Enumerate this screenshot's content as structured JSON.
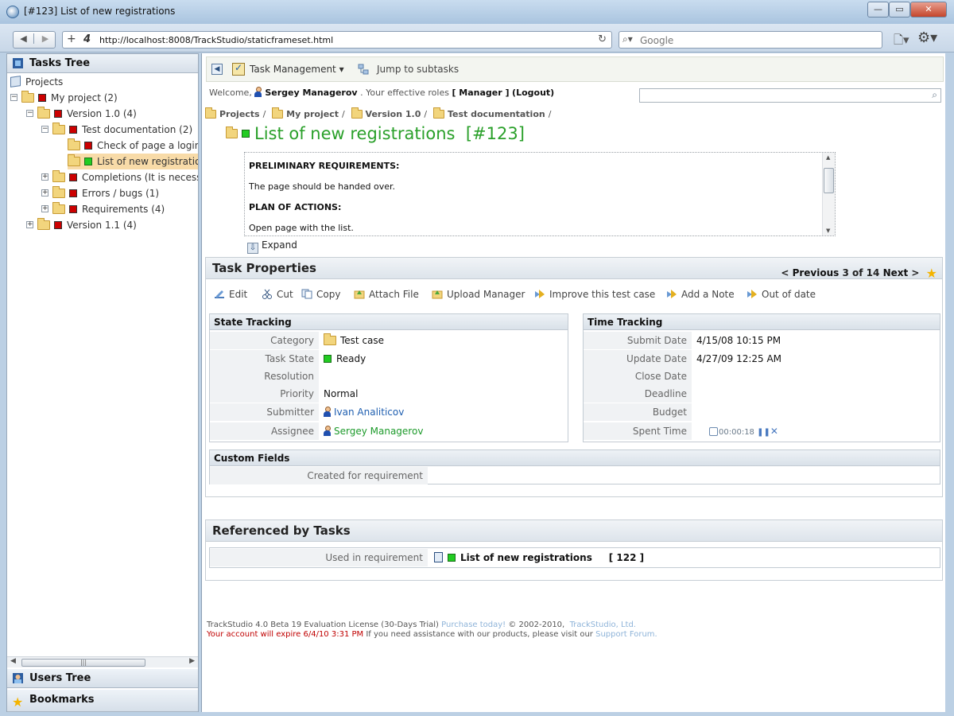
{
  "window": {
    "title": "[#123] List of new registrations",
    "url": "http://localhost:8008/TrackStudio/staticframeset.html",
    "search_placeholder": "Google"
  },
  "left": {
    "tasks_tree_title": "Tasks Tree",
    "tree": [
      {
        "label": "Projects"
      },
      {
        "label": "My project (2)"
      },
      {
        "label": "Version 1.0 (4)"
      },
      {
        "label": "Test documentation (2)"
      },
      {
        "label": "Check of page a login"
      },
      {
        "label": "List of new registrations"
      },
      {
        "label": "Completions (It is necessary"
      },
      {
        "label": "Errors / bugs (1)"
      },
      {
        "label": "Requirements (4)"
      },
      {
        "label": "Version 1.1 (4)"
      }
    ],
    "users_tree_title": "Users Tree",
    "bookmarks_title": "Bookmarks"
  },
  "main": {
    "task_management": "Task Management",
    "jump": "Jump to subtasks",
    "welcome_prefix": "Welcome,",
    "user": "Sergey Managerov",
    "roles_text": ". Your effective roles",
    "role": "[ Manager ]",
    "logout": "(Logout)",
    "breadcrumbs": [
      "Projects",
      "My project",
      "Version 1.0",
      "Test documentation"
    ],
    "task_title": "List of new registrations",
    "task_number": "[#123]",
    "description": [
      {
        "text": "PRELIMINARY REQUIREMENTS:"
      },
      {
        "text": "The page should be handed over."
      },
      {
        "text": "PLAN OF ACTIONS:"
      },
      {
        "text": "Open page with the list."
      }
    ],
    "expand": "Expand"
  },
  "properties": {
    "title": "Task Properties",
    "pager": {
      "previous": "Previous",
      "current": "3",
      "of": "of",
      "total": "14",
      "next": "Next"
    },
    "actions": [
      "Edit",
      "Cut",
      "Copy",
      "Attach File",
      "Upload Manager",
      "Improve this test case",
      "Add a Note",
      "Out of date"
    ],
    "state": {
      "title": "State Tracking",
      "rows": [
        {
          "label": "Category",
          "value": "Test case"
        },
        {
          "label": "Task State",
          "value": "Ready"
        },
        {
          "label": "Resolution",
          "value": ""
        },
        {
          "label": "Priority",
          "value": "Normal"
        },
        {
          "label": "Submitter",
          "value": "Ivan Analiticov"
        },
        {
          "label": "Assignee",
          "value": "Sergey Managerov"
        }
      ]
    },
    "time": {
      "title": "Time Tracking",
      "rows": [
        {
          "label": "Submit Date",
          "value": "4/15/08 10:15 PM"
        },
        {
          "label": "Update Date",
          "value": "4/27/09 12:25 AM"
        },
        {
          "label": "Close Date",
          "value": ""
        },
        {
          "label": "Deadline",
          "value": ""
        },
        {
          "label": "Budget",
          "value": ""
        },
        {
          "label": "Spent Time",
          "value": "00:00:18"
        }
      ]
    },
    "custom": {
      "title": "Custom Fields",
      "row_label": "Created for requirement",
      "row_value": ""
    }
  },
  "referenced": {
    "title": "Referenced by Tasks",
    "label": "Used in requirement",
    "task": "List of new registrations",
    "number": "[ 122 ]"
  },
  "footer": {
    "license": "TrackStudio 4.0 Beta 19 Evaluation License (30-Days Trial)",
    "purchase": "Purchase today!",
    "copyright": "© 2002-2010,",
    "company": "TrackStudio, Ltd.",
    "expire": "Your account will expire 6/4/10 3:31 PM",
    "assist": "If you need assistance with our products, please visit our",
    "forum": "Support Forum."
  },
  "colors": {
    "accent_green": "#2aa02a",
    "link_blue": "#1f5fb0",
    "state_red": "#cc0000",
    "state_green": "#22cc22"
  }
}
